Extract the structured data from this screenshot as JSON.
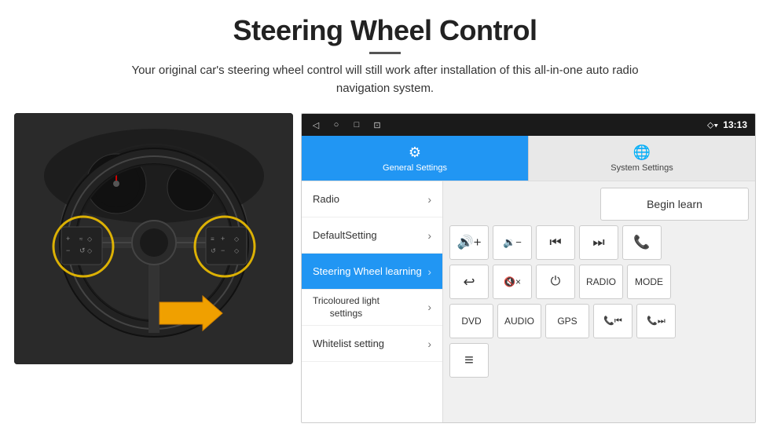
{
  "header": {
    "title": "Steering Wheel Control",
    "subtitle": "Your original car's steering wheel control will still work after installation of this all-in-one auto radio navigation system."
  },
  "status_bar": {
    "nav_back": "◁",
    "nav_home": "○",
    "nav_recent": "□",
    "nav_extra": "⊡",
    "signal": "▾",
    "wifi": "▾",
    "time": "13:13"
  },
  "tabs": [
    {
      "id": "general",
      "label": "General Settings",
      "icon": "⚙",
      "active": true
    },
    {
      "id": "system",
      "label": "System Settings",
      "icon": "🌐",
      "active": false
    }
  ],
  "menu_items": [
    {
      "id": "radio",
      "label": "Radio",
      "active": false
    },
    {
      "id": "default",
      "label": "DefaultSetting",
      "active": false
    },
    {
      "id": "steering",
      "label": "Steering Wheel learning",
      "active": true
    },
    {
      "id": "tricoloured",
      "label": "Tricoloured light settings",
      "active": false
    },
    {
      "id": "whitelist",
      "label": "Whitelist setting",
      "active": false
    }
  ],
  "controls": {
    "begin_learn": "Begin learn",
    "row1": [
      {
        "id": "vol_up",
        "label": "🔊+",
        "type": "icon"
      },
      {
        "id": "vol_down",
        "label": "🔉−",
        "type": "icon"
      },
      {
        "id": "prev",
        "label": "⏮",
        "type": "icon"
      },
      {
        "id": "next",
        "label": "⏭",
        "type": "icon"
      },
      {
        "id": "phone",
        "label": "📞",
        "type": "icon"
      }
    ],
    "row2": [
      {
        "id": "back",
        "label": "↩",
        "type": "icon"
      },
      {
        "id": "mute",
        "label": "🔇×",
        "type": "icon"
      },
      {
        "id": "power",
        "label": "⏻",
        "type": "icon"
      },
      {
        "id": "radio_btn",
        "label": "RADIO",
        "type": "text"
      },
      {
        "id": "mode_btn",
        "label": "MODE",
        "type": "text"
      }
    ],
    "row3": [
      {
        "id": "dvd_btn",
        "label": "DVD",
        "type": "text"
      },
      {
        "id": "audio_btn",
        "label": "AUDIO",
        "type": "text"
      },
      {
        "id": "gps_btn",
        "label": "GPS",
        "type": "text"
      },
      {
        "id": "phone_prev",
        "label": "📞⏮",
        "type": "icon"
      },
      {
        "id": "phone_next",
        "label": "📞⏭",
        "type": "icon"
      }
    ],
    "row4": [
      {
        "id": "list_btn",
        "label": "≡",
        "type": "icon"
      }
    ]
  }
}
